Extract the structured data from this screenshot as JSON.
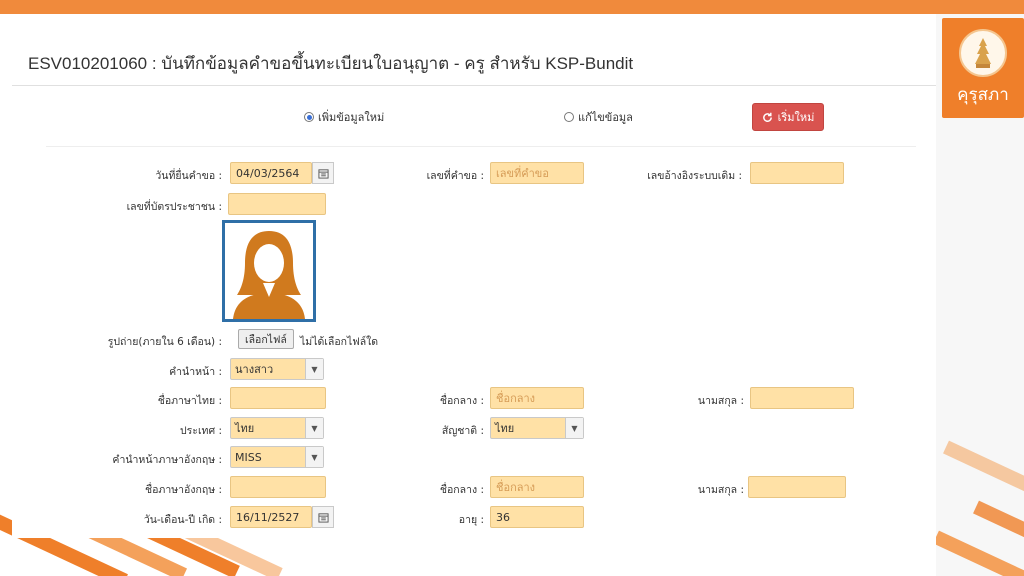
{
  "page": {
    "title": "ESV010201060 : บันทึกข้อมูลคำขอขึ้นทะเบียนใบอนุญาต - ครู สำหรับ KSP-Bundit"
  },
  "logo": {
    "text": "คุรุสภา"
  },
  "mode": {
    "add_label": "เพิ่มข้อมูลใหม่",
    "edit_label": "แก้ไขข้อมูล",
    "selected": "add",
    "reset_label": "เริ่มใหม่"
  },
  "form": {
    "request_date": {
      "label": "วันที่ยื่นคำขอ :",
      "value": "04/03/2564"
    },
    "request_no": {
      "label": "เลขที่คำขอ :",
      "placeholder": "เลขที่คำขอ"
    },
    "old_ref": {
      "label": "เลขอ้างอิงระบบเดิม :",
      "value": ""
    },
    "id_card": {
      "label": "เลขที่บัตรประชาชน :",
      "value": ""
    },
    "photo": {
      "label": "รูปถ่าย(ภายใน 6 เดือน) :",
      "button": "เลือกไฟล์",
      "status": "ไม่ได้เลือกไฟล์ใด"
    },
    "prefix_th": {
      "label": "คำนำหน้า :",
      "value": "นางสาว"
    },
    "name_th": {
      "label": "ชื่อภาษาไทย :",
      "value": ""
    },
    "middle_th": {
      "label": "ชื่อกลาง :",
      "placeholder": "ชื่อกลาง"
    },
    "surname_th": {
      "label": "นามสกุล :",
      "value": ""
    },
    "country": {
      "label": "ประเทศ :",
      "value": "ไทย"
    },
    "nationality": {
      "label": "สัญชาติ :",
      "value": "ไทย"
    },
    "prefix_en": {
      "label": "คำนำหน้าภาษาอังกฤษ :",
      "value": "MISS"
    },
    "name_en": {
      "label": "ชื่อภาษาอังกฤษ :",
      "value": ""
    },
    "middle_en": {
      "label": "ชื่อกลาง :",
      "placeholder": "ชื่อกลาง"
    },
    "surname_en": {
      "label": "นามสกุล :",
      "value": ""
    },
    "birth_date": {
      "label": "วัน-เดือน-ปี เกิด :",
      "value": "16/11/2527"
    },
    "age": {
      "label": "อายุ :",
      "value": "36"
    }
  },
  "colors": {
    "accent": "#ef7f2a",
    "field_bg": "#ffe1a6",
    "reset_button": "#d9534f",
    "photo_border": "#2f6fa7"
  },
  "icons": {
    "calendar": "calendar-icon",
    "refresh": "refresh-icon",
    "dropdown": "chevron-down-icon",
    "avatar": "female-avatar-icon",
    "logo": "seal-logo-icon"
  }
}
